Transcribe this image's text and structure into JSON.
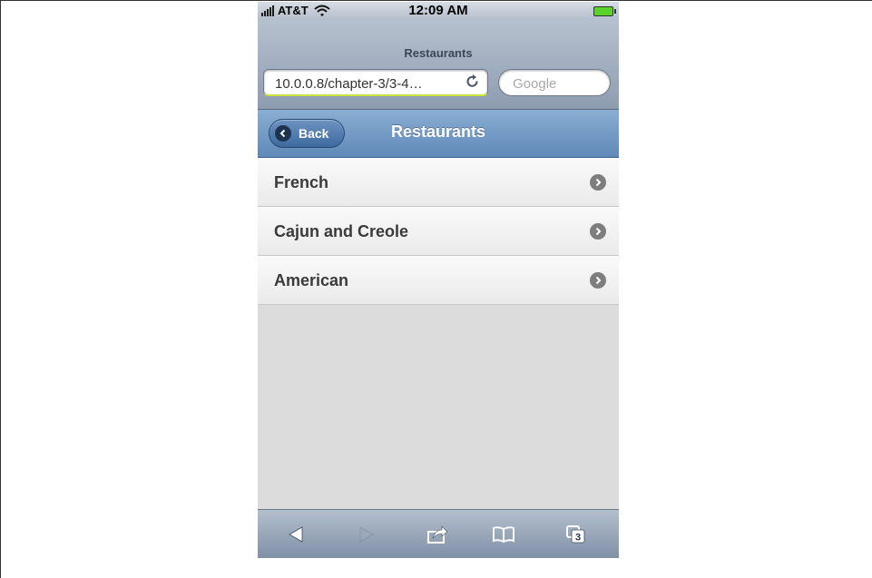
{
  "status_bar": {
    "carrier": "AT&T",
    "time": "12:09 AM"
  },
  "browser": {
    "page_title": "Restaurants",
    "url": "10.0.0.8/chapter-3/3-4…",
    "search_placeholder": "Google"
  },
  "toolbar": {
    "back_label": "Back",
    "title": "Restaurants"
  },
  "list": {
    "items": [
      {
        "label": "French"
      },
      {
        "label": "Cajun and Creole"
      },
      {
        "label": "American"
      }
    ]
  },
  "bottom_bar": {
    "tabs_count": "3",
    "icons": [
      "back-arrow-icon",
      "forward-arrow-icon",
      "share-icon",
      "bookmarks-icon",
      "tabs-icon"
    ]
  },
  "colors": {
    "toolbar_blue": "#6f97c4",
    "battery_green": "#5bd22a"
  }
}
